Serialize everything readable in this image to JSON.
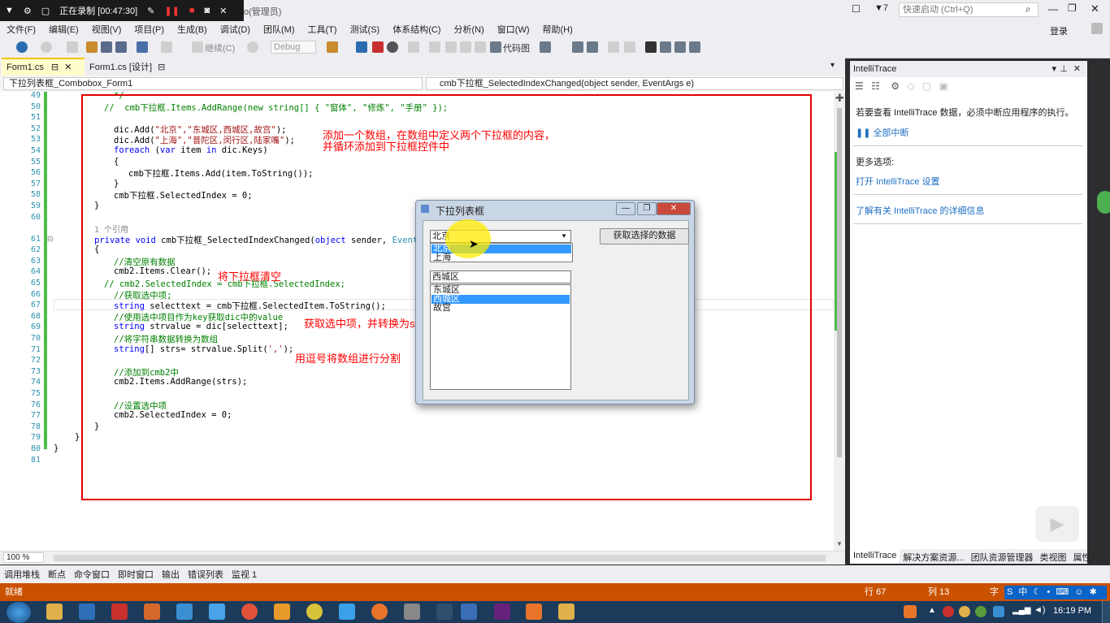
{
  "recorder": {
    "status": "正在录制 [00:47:30]"
  },
  "window": {
    "title_suffix": "o(管理员)",
    "quick_launch_placeholder": "快速启动 (Ctrl+Q)",
    "notif_count": "7",
    "login_label": "登录"
  },
  "menu": [
    "文件(F)",
    "编辑(E)",
    "视图(V)",
    "项目(P)",
    "生成(B)",
    "调试(D)",
    "团队(M)",
    "工具(T)",
    "测试(S)",
    "体系结构(C)",
    "分析(N)",
    "窗口(W)",
    "帮助(H)"
  ],
  "toolbar": {
    "continue_label": "继续(C)",
    "config": "Debug",
    "codemap_label": "代码图"
  },
  "tabs": {
    "active": "Form1.cs",
    "design": "Form1.cs [设计]"
  },
  "navbar": {
    "left": "下拉列表框_Combobox_Form1",
    "right": "cmb下拉框_SelectedIndexChanged(object sender, EventArgs e)"
  },
  "code": {
    "line_numbers": [
      "49",
      "50",
      "51",
      "52",
      "53",
      "54",
      "55",
      "56",
      "57",
      "58",
      "59",
      "60",
      "",
      "61",
      "62",
      "63",
      "64",
      "65",
      "66",
      "67",
      "68",
      "69",
      "70",
      "71",
      "72",
      "73",
      "74",
      "75",
      "76",
      "77",
      "78",
      "79",
      "80",
      "81"
    ],
    "l49": "*/",
    "l50": "//  cmb下拉框.Items.AddRange(new string[] { \"窗体\", \"修炼\", \"手册\" });",
    "l52a": "dic.Add(",
    "l52s": "\"北京\",\"东城区,西城区,故宫\"",
    "l52b": ");",
    "l53a": "dic.Add(",
    "l53s": "\"上海\",\"普陀区,闵行区,陆家嘴\"",
    "l53b": ");",
    "l54k": "foreach",
    "l54a": " (",
    "l54k2": "var",
    "l54b": " item ",
    "l54k3": "in",
    "l54c": " dic.Keys)",
    "l55": "{",
    "l56": "cmb下拉框.Items.Add(item.ToString());",
    "l57": "}",
    "l58": "cmb下拉框.SelectedIndex = 0;",
    "l59": "}",
    "ref": "1 个引用",
    "l61k": "private void",
    "l61a": " cmb下拉框_SelectedIndexChanged(",
    "l61k2": "object",
    "l61b": " sender, ",
    "l61t": "EventArgs",
    "l62": "{",
    "l63": "//清空原有数据",
    "l64": "cmb2.Items.Clear();",
    "l65": "// cmb2.SelectedIndex = cmb下拉框.SelectedIndex;",
    "l66": "//获取选中项;",
    "l67k": "string",
    "l67a": " selecttext = cmb下拉框.SelectedItem.ToString();",
    "l68": "//使用选中项目作为key获取dic中的value",
    "l69k": "string",
    "l69a": " strvalue = dic[selecttext];",
    "l70": "//将字符串数据转换为数组",
    "l71k": "string",
    "l71a": "[] strs= strvalue.Split(",
    "l71s": "','",
    "l71b": ");",
    "l73": "//添加到cmb2中",
    "l74": "cmb2.Items.AddRange(strs);",
    "l76": "//设置选中项",
    "l77": "cmb2.SelectedIndex = 0;",
    "l78": "}",
    "l79": "}",
    "l80": "}"
  },
  "annotations": {
    "a1_line1": "添加一个数组，在数组中定义两个下拉框的内容，",
    "a1_line2": "并循环添加到下拉框控件中",
    "a2": "将下拉框清空",
    "a3": "获取选中项，并转换为string类型",
    "a4": "用逗号将数组进行分割"
  },
  "zoom": "100 %",
  "dialog": {
    "title": "下拉列表框",
    "combo_value": "北京",
    "combo_options": [
      "北京",
      "上海"
    ],
    "get_button": "获取选择的数据",
    "combo2_value": "西城区",
    "list_items": [
      "东城区",
      "西城区",
      "故宫"
    ],
    "selected_index": 1
  },
  "intellitrace": {
    "title": "IntelliTrace",
    "msg": "若要查看 IntelliTrace 数据，必须中断应用程序的执行。",
    "break_all": "全部中断",
    "more_options": "更多选项:",
    "open_settings": "打开 IntelliTrace 设置",
    "learn_more": "了解有关 IntelliTrace 的详细信息",
    "tabs": [
      "IntelliTrace",
      "解决方案资源...",
      "团队资源管理器",
      "类视图",
      "属性"
    ]
  },
  "bottom_tabs": [
    "调用堆栈",
    "断点",
    "命令窗口",
    "即时窗口",
    "输出",
    "错误列表",
    "监视 1"
  ],
  "status": {
    "ready": "就绪",
    "row": "行 67",
    "col": "列 13",
    "char": "字"
  },
  "clock": "16:19 PM",
  "ime": "中"
}
